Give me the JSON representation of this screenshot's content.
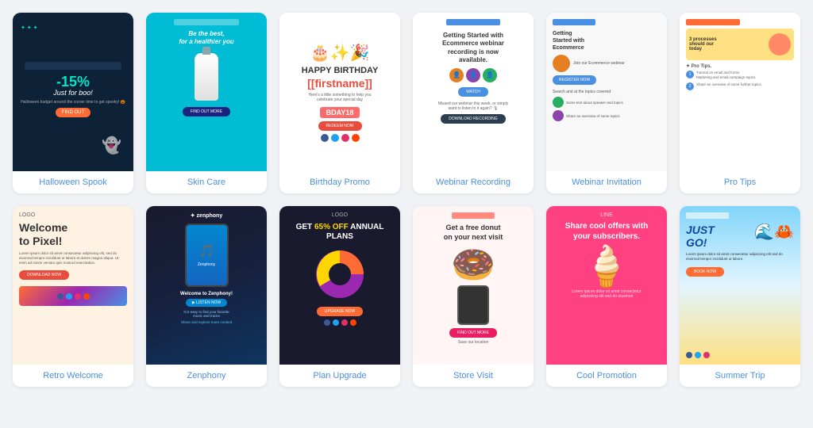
{
  "cards": [
    {
      "id": "halloween-spook",
      "label": "Halloween Spook",
      "preview_type": "halloween"
    },
    {
      "id": "skin-care",
      "label": "Skin Care",
      "preview_type": "skincare"
    },
    {
      "id": "birthday-promo",
      "label": "Birthday Promo",
      "preview_type": "birthday"
    },
    {
      "id": "webinar-recording",
      "label": "Webinar Recording",
      "preview_type": "webinar"
    },
    {
      "id": "webinar-invitation",
      "label": "Webinar Invitation",
      "preview_type": "webinar-inv"
    },
    {
      "id": "pro-tips",
      "label": "Pro Tips",
      "preview_type": "protips"
    },
    {
      "id": "retro-welcome",
      "label": "Retro Welcome",
      "preview_type": "retro"
    },
    {
      "id": "zenphony",
      "label": "Zenphony",
      "preview_type": "zenphony"
    },
    {
      "id": "plan-upgrade",
      "label": "Plan Upgrade",
      "preview_type": "plan"
    },
    {
      "id": "store-visit",
      "label": "Store Visit",
      "preview_type": "store"
    },
    {
      "id": "cool-promotion",
      "label": "Cool Promotion",
      "preview_type": "cool"
    },
    {
      "id": "summer-trip",
      "label": "Summer Trip",
      "preview_type": "summer"
    }
  ],
  "labels": {
    "halloween": "Halloween Spook",
    "skincare": "Skin Care",
    "birthday": "Birthday Promo",
    "webinar": "Webinar Recording",
    "webinar-inv": "Webinar Invitation",
    "protips": "Pro Tips",
    "retro": "Retro Welcome",
    "zenphony": "Zenphony",
    "plan": "Plan Upgrade",
    "store": "Store Visit",
    "cool": "Cool Promotion",
    "summer": "Summer Trip"
  }
}
